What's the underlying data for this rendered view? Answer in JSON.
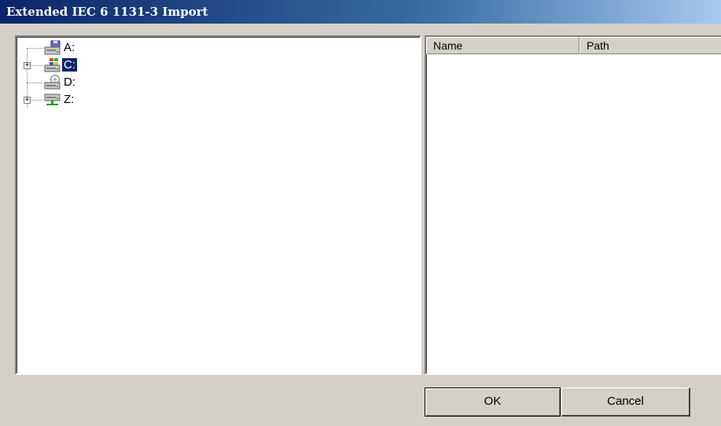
{
  "window": {
    "title": "Extended IEC 6 1131-3 Import"
  },
  "tree": {
    "items": [
      {
        "label": "A:",
        "icon": "floppy-drive-icon",
        "expandable": false,
        "selected": false
      },
      {
        "label": "C:",
        "icon": "windows-drive-icon",
        "expandable": true,
        "selected": true
      },
      {
        "label": "D:",
        "icon": "cd-drive-icon",
        "expandable": false,
        "selected": false
      },
      {
        "label": "Z:",
        "icon": "network-drive-icon",
        "expandable": true,
        "selected": false
      }
    ],
    "expander_symbol": "+"
  },
  "list": {
    "columns": [
      {
        "label": "Name"
      },
      {
        "label": "Path"
      }
    ]
  },
  "buttons": {
    "ok_label": "OK",
    "cancel_label": "Cancel"
  }
}
